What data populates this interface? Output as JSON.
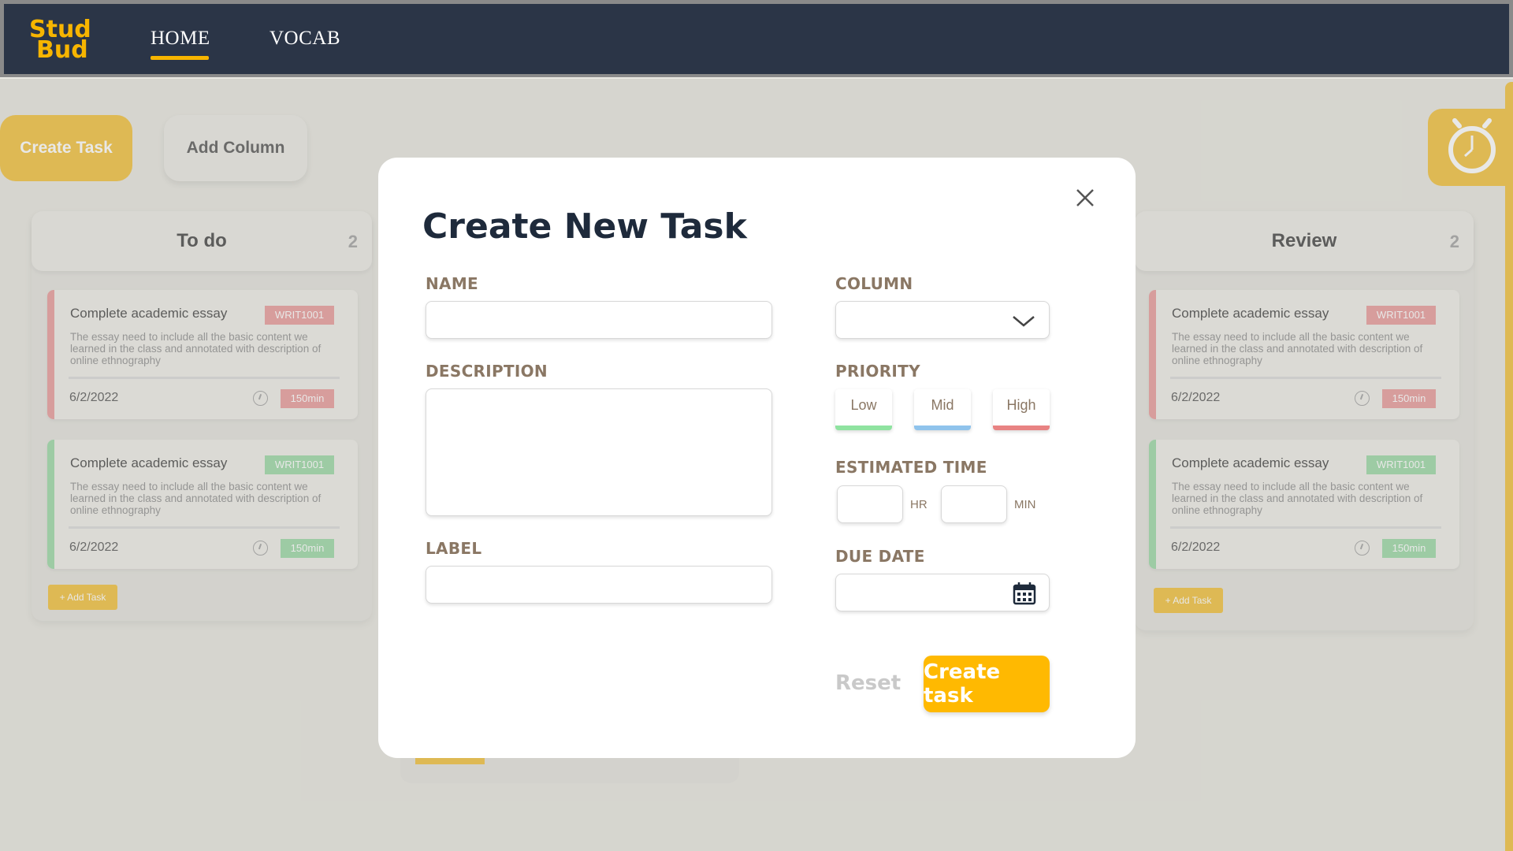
{
  "app": {
    "logo_line1": "Stud",
    "logo_line2": "Bud",
    "nav": [
      {
        "label": "HOME",
        "active": true
      },
      {
        "label": "VOCAB",
        "active": false
      }
    ]
  },
  "board": {
    "create_task_label": "Create Task",
    "add_column_label": "Add Column",
    "columns": [
      {
        "title": "To do",
        "count": "2",
        "add_task_label": "+ Add Task",
        "cards": [
          {
            "title": "Complete academic essay",
            "badge": "WRIT1001",
            "description": "The essay need to include all the basic content we learned in the class and annotated with description of online ethnography",
            "date": "6/2/2022",
            "time": "150min",
            "priority_color": "#eba4a4"
          },
          {
            "title": "Complete academic essay",
            "badge": "WRIT1001",
            "description": "The essay need to include all the basic content we learned in the class and annotated with description of online ethnography",
            "date": "6/2/2022",
            "time": "150min",
            "priority_color": "#a4dcae"
          }
        ]
      },
      {
        "title": "Review",
        "count": "2",
        "add_task_label": "+ Add Task",
        "cards": [
          {
            "title": "Complete academic essay",
            "badge": "WRIT1001",
            "description": "The essay need to include all the basic content we learned in the class and annotated with description of online ethnography",
            "date": "6/2/2022",
            "time": "150min",
            "priority_color": "#eba4a4"
          },
          {
            "title": "Complete academic essay",
            "badge": "WRIT1001",
            "description": "The essay need to include all the basic content we learned in the class and annotated with description of online ethnography",
            "date": "6/2/2022",
            "time": "150min",
            "priority_color": "#a4dcae"
          }
        ]
      }
    ]
  },
  "modal": {
    "title": "Create New Task",
    "name_label": "NAME",
    "name_value": "",
    "description_label": "DESCRIPTION",
    "description_value": "",
    "label_label": "LABEL",
    "label_value": "",
    "column_label": "COLUMN",
    "column_value": "",
    "priority_label": "PRIORITY",
    "priority_options": [
      "Low",
      "Mid",
      "High"
    ],
    "estimated_time_label": "ESTIMATED TIME",
    "hr_unit": "HR",
    "min_unit": "MIN",
    "due_date_label": "DUE DATE",
    "due_date_value": "",
    "reset_label": "Reset",
    "submit_label": "Create task"
  },
  "colors": {
    "accent": "#ffb901",
    "navbar": "#2b3547",
    "priority_low": "#8fe3a0",
    "priority_mid": "#8fc3ec",
    "priority_high": "#e88383"
  }
}
